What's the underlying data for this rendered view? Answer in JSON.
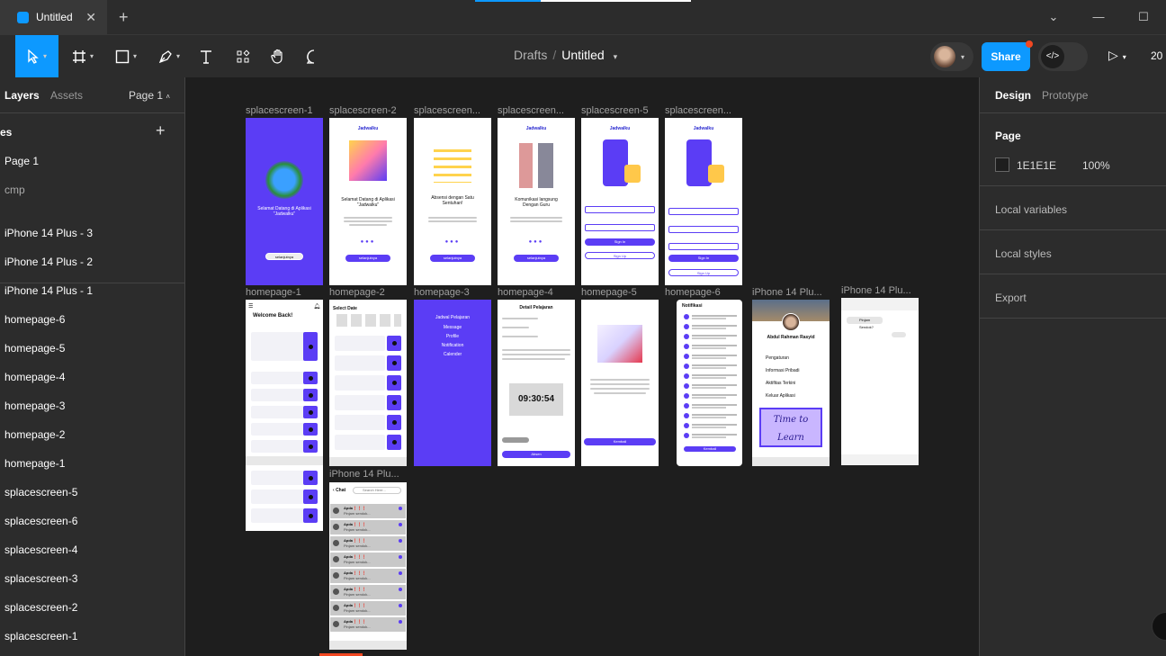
{
  "titlebar": {
    "tab_title": "Untitled",
    "tab_close": "✕",
    "new_tab": "+",
    "window_controls": [
      "⌄",
      "—",
      "☐"
    ]
  },
  "toolbar": {
    "breadcrumb_drafts": "Drafts",
    "breadcrumb_sep": "/",
    "file_name": "Untitled",
    "share_label": "Share",
    "zoom": "20"
  },
  "left_panel": {
    "tab_layers": "Layers",
    "tab_assets": "Assets",
    "page_selector": "Page 1",
    "pages_heading": "es",
    "pages": [
      "Page 1",
      "cmp"
    ],
    "layers": [
      "iPhone 14 Plus - 3",
      "iPhone 14 Plus - 2",
      "iPhone 14 Plus - 1",
      "homepage-6",
      "homepage-5",
      "homepage-4",
      "homepage-3",
      "homepage-2",
      "homepage-1",
      "splacescreen-5",
      "splacescreen-6",
      "splacescreen-4",
      "splacescreen-3",
      "splacescreen-2",
      "splacescreen-1"
    ]
  },
  "right_panel": {
    "tab_design": "Design",
    "tab_prototype": "Prototype",
    "page_heading": "Page",
    "page_color": "1E1E1E",
    "page_opacity": "100%",
    "local_variables": "Local variables",
    "local_styles": "Local styles",
    "export": "Export"
  },
  "canvas": {
    "frame_labels": [
      "splacescreen-1",
      "splacescreen-2",
      "splacescreen...",
      "splacescreen...",
      "splacescreen-5",
      "splacescreen...",
      "homepage-1",
      "homepage-2",
      "homepage-3",
      "homepage-4",
      "homepage-5",
      "homepage-6",
      "iPhone 14 Plu...",
      "iPhone 14 Plu...",
      "iPhone 14 Plu..."
    ],
    "splash": {
      "app_name": "Jadwalku",
      "welcome_1": "Selamat Datang di Aplikasi \"Jadwalku\"",
      "welcome_2": "Selamat Datang di Aplikasi \"Jadwalku\"",
      "title_3": "Absensi dengan Satu Sentuhan!",
      "title_4": "Komunikasi langsung Dengan Guru",
      "next_button": "selanjutnya",
      "sign_in": "Sign In",
      "sign_up": "Sign Up"
    },
    "homepage": {
      "welcome_back": "Welcome Back!",
      "select_date": "Select Date",
      "menu": [
        "Jadwal Pelajaran",
        "Message",
        "Profile",
        "Notification",
        "Calender"
      ],
      "detail_title": "Detail Pelajaran",
      "timer": "09:30:54",
      "absen": "Absen",
      "kembali": "Kembali",
      "notifikasi": "Notifikasi",
      "profile_name": "Abdul Rahman Rasyid",
      "profile_menu": [
        "Pengaturan",
        "Informasi Pribadi",
        "Aktifitas Terkini",
        "Keluar Aplikasi"
      ],
      "poster_text": "Time to Learn",
      "chat_title": "Chat",
      "chat_search": "Search Here...",
      "chat_contact": "Apda❗❗❗",
      "chat_preview": "Pinjam sendok...",
      "chat_bubble": "Pinjam Sendok?"
    }
  },
  "colors": {
    "accent": "#0d99ff",
    "brand_purple": "#5b3df5",
    "canvas_bg": "#1e1e1e",
    "panel_bg": "#2c2c2c"
  }
}
